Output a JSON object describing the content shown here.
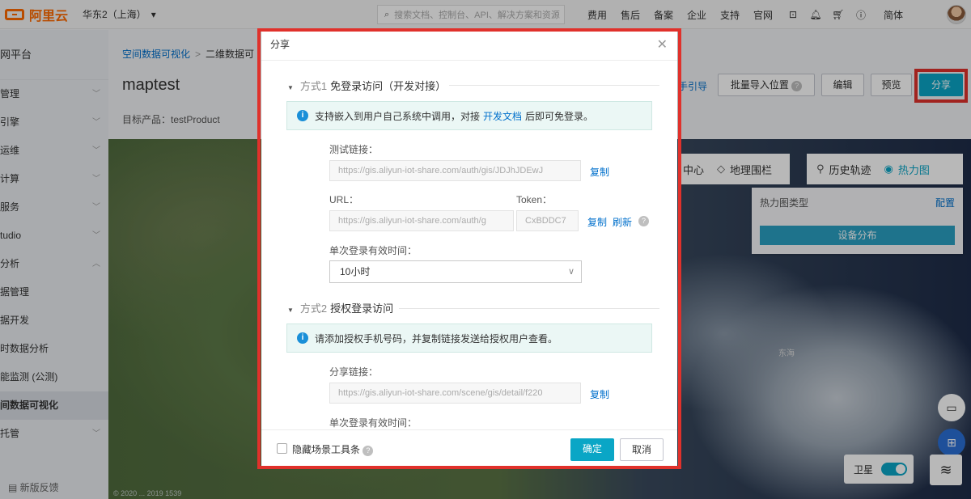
{
  "topbar": {
    "logo_text": "阿里云",
    "region": "华东2（上海）",
    "search_placeholder": "搜索文档、控制台、API、解决方案和资源",
    "nav": [
      "费用",
      "售后",
      "备案",
      "企业",
      "支持",
      "官网"
    ],
    "lang": "简体",
    "icons": [
      "terminal-icon",
      "bell-icon",
      "cart-icon",
      "help-icon"
    ]
  },
  "sidebar": {
    "title": "网平台",
    "items": [
      {
        "label": "管理",
        "chev": "﹀"
      },
      {
        "label": "引擎",
        "chev": "﹀"
      },
      {
        "label": "运维",
        "chev": "﹀"
      },
      {
        "label": "计算",
        "chev": "﹀"
      },
      {
        "label": "服务",
        "chev": "﹀"
      },
      {
        "label": "tudio",
        "chev": "﹀"
      },
      {
        "label": "分析",
        "chev": "︿"
      },
      {
        "label": "据管理",
        "chev": ""
      },
      {
        "label": "据开发",
        "chev": ""
      },
      {
        "label": "时数据分析",
        "chev": ""
      },
      {
        "label": "能监测 (公测)",
        "chev": ""
      },
      {
        "label": "间数据可视化",
        "chev": ""
      },
      {
        "label": "托管",
        "chev": "﹀"
      }
    ],
    "feedback": "新版反馈"
  },
  "header": {
    "breadcrumb_link": "空间数据可视化",
    "breadcrumb_sep": ">",
    "breadcrumb_current": "二维数据可",
    "title": "maptest",
    "product": "目标产品：testProduct",
    "guide": "手引导",
    "buttons": {
      "batch_import": "批量导入位置",
      "edit": "编辑",
      "preview": "预览",
      "share": "分享"
    }
  },
  "map": {
    "toolbar": {
      "center": "中心",
      "geofence": "地理围栏",
      "history": "历史轨迹",
      "heatmap": "热力图"
    },
    "heat_panel": {
      "type_label": "热力图类型",
      "config": "配置",
      "distribution": "设备分布"
    },
    "satellite": "卫星",
    "satellite_on": true,
    "labels": [
      "东海"
    ],
    "attribution": "© 2020 ... 2019 1539"
  },
  "dialog": {
    "title": "分享",
    "section1": {
      "method": "方式1",
      "title": "免登录访问（开发对接）",
      "info_pre": "支持嵌入到用户自己系统中调用，对接",
      "info_link": "开发文档",
      "info_post": "后即可免登录。",
      "test_link_label": "测试链接：",
      "test_link_value": "https://gis.aliyun-iot-share.com/auth/gis/JDJhJDEwJ",
      "copy": "复制",
      "url_label": "URL：",
      "url_value": "https://gis.aliyun-iot-share.com/auth/g",
      "token_label": "Token：",
      "token_value": "CxBDDC7",
      "refresh": "刷新",
      "expiry_label": "单次登录有效时间：",
      "expiry_value": "10小时"
    },
    "section2": {
      "method": "方式2",
      "title": "授权登录访问",
      "info": "请添加授权手机号码，并复制链接发送给授权用户查看。",
      "share_link_label": "分享链接：",
      "share_link_value": "https://gis.aliyun-iot-share.com/scene/gis/detail/f220",
      "copy": "复制",
      "expiry_label": "单次登录有效时间："
    },
    "footer": {
      "hide_toolbar": "隐藏场景工具条",
      "confirm": "确定",
      "cancel": "取消"
    }
  },
  "colors": {
    "primary": "#0aa6c6",
    "link": "#0070cc",
    "highlight": "#e0312b",
    "brand": "#ff6a00"
  }
}
